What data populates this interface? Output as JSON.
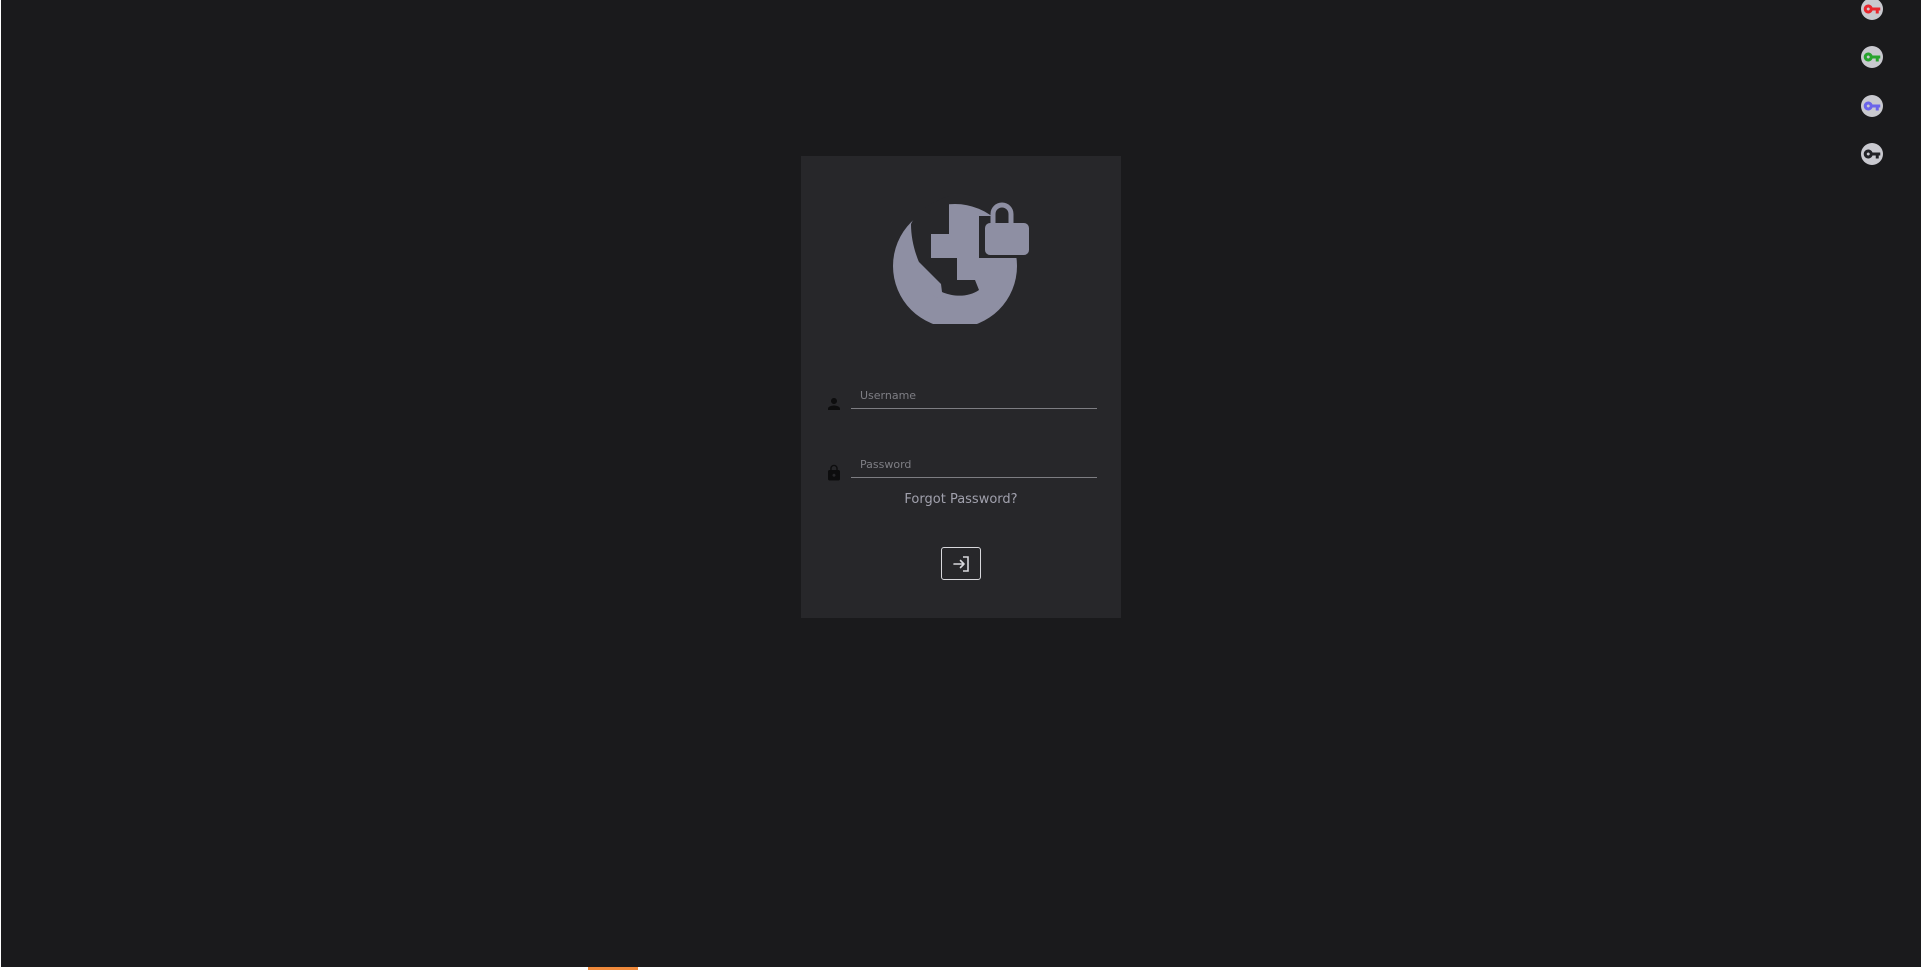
{
  "theme": {
    "background": "#1a1a1c",
    "card": "#27272a",
    "logo": "#8e8fa3",
    "text_muted": "#a1a1ad",
    "field_line": "#7d7d82"
  },
  "quick_login_keys": [
    {
      "icon": "key-icon",
      "color": "#e8262d"
    },
    {
      "icon": "key-icon",
      "color": "#27a32d"
    },
    {
      "icon": "key-icon",
      "color": "#6b64ea"
    },
    {
      "icon": "key-icon",
      "color": "#222226"
    }
  ],
  "login": {
    "logo_icon": "globe-lock-icon",
    "username": {
      "icon": "person-icon",
      "placeholder": "Username",
      "value": ""
    },
    "password": {
      "icon": "lock-icon",
      "placeholder": "Password",
      "value": ""
    },
    "forgot_password_label": "Forgot Password?",
    "submit_icon": "login-arrow-icon"
  }
}
